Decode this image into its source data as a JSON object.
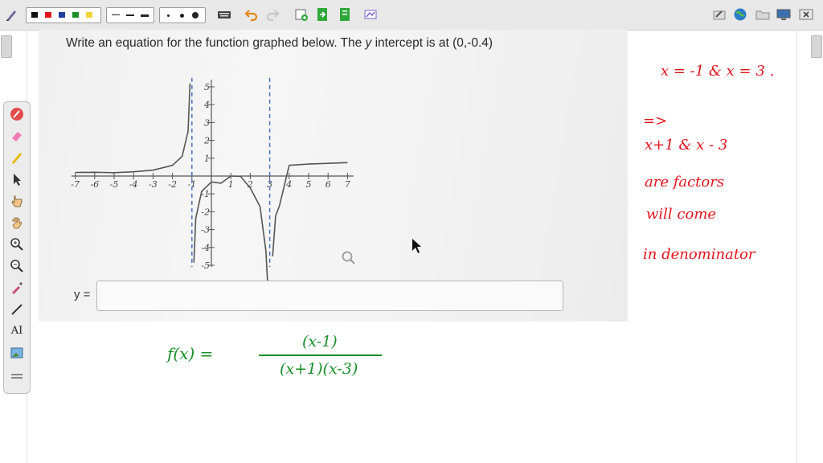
{
  "toolbar": {
    "colors": [
      "#111111",
      "#e0141d",
      "#1f3f9f",
      "#1a8f2a",
      "#f2d43a"
    ],
    "icons": [
      "pen-icon",
      "keyboard-icon",
      "undo-icon",
      "redo-icon",
      "new-page-icon",
      "next-page-icon",
      "page-icon",
      "screenshot-icon",
      "edit-icon",
      "globe-icon",
      "folder-icon",
      "monitor-icon",
      "close-icon"
    ]
  },
  "palette": {
    "tools": [
      "pen-icon",
      "eraser-icon",
      "highlighter-icon",
      "pointer-icon",
      "hand-pointer-icon",
      "hand-icon",
      "zoom-in-icon",
      "zoom-out-icon",
      "dropper-icon",
      "line-icon",
      "text-icon",
      "image-icon",
      "more-icon"
    ],
    "text_tool_label": "AI"
  },
  "question": {
    "prefix": "Write an equation for the function graphed below. The ",
    "variable": "y",
    "suffix": " intercept is at (0,-0.4)"
  },
  "answer": {
    "label": "y ="
  },
  "chart_data": {
    "type": "line",
    "title": "",
    "xlabel": "",
    "ylabel": "",
    "xlim": [
      -7,
      7
    ],
    "ylim": [
      -5,
      5
    ],
    "x_ticks": [
      -7,
      -6,
      -5,
      -4,
      -3,
      -2,
      -1,
      1,
      2,
      3,
      4,
      5,
      6,
      7
    ],
    "y_ticks": [
      -5,
      -4,
      -3,
      -2,
      -1,
      1,
      2,
      3,
      4,
      5
    ],
    "vertical_asymptotes": [
      -1,
      3
    ],
    "y_intercept": [
      0,
      -0.4
    ],
    "function": "(x-1)/((x+1)(x-3))",
    "series": [
      {
        "x": [
          -7,
          -6,
          -5,
          -4,
          -3,
          -2,
          -1.5,
          -1.2,
          -1.1
        ],
        "y": [
          0.2,
          0.21,
          0.19,
          0.24,
          0.33,
          0.6,
          1.11,
          2.5,
          5.2
        ]
      },
      {
        "x": [
          -0.9,
          -0.8,
          -0.5,
          0,
          0.5,
          1,
          1.5,
          2,
          2.5,
          2.8,
          2.9
        ],
        "y": [
          -4.85,
          -2.37,
          -0.86,
          -0.33,
          -0.4,
          0,
          -0.02,
          -0.67,
          -1.71,
          -4.17,
          -8.5
        ]
      },
      {
        "x": [
          3.15,
          3.3,
          3.5,
          4,
          5,
          6,
          7
        ],
        "y": [
          -4.5,
          -2.24,
          -1.67,
          0.6,
          0.67,
          0.71,
          0.75
        ]
      }
    ]
  },
  "notes": {
    "line1": "x = -1  &  x = 3 .",
    "arrow": "=>",
    "line2": "x+1   &   x - 3",
    "line3": "are  factors",
    "line4": "will  come",
    "line5": "in  denominator"
  },
  "solution": {
    "lhs": "f(x) =",
    "numerator": "(x-1)",
    "denominator": "(x+1)(x-3)"
  }
}
